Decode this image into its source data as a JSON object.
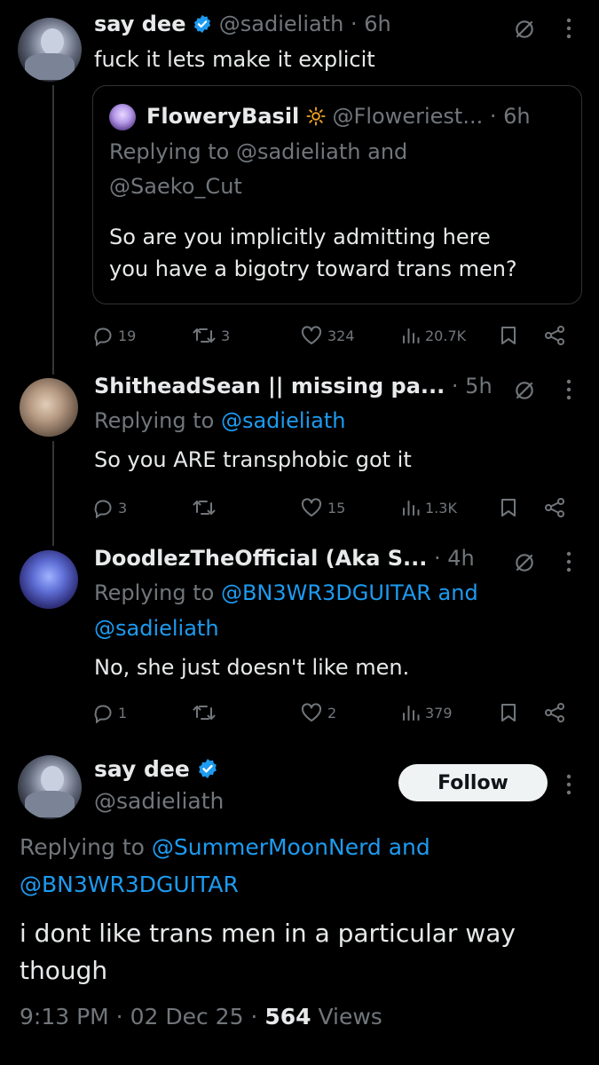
{
  "post1": {
    "display_name": "say dee",
    "handle": "@sadieliath",
    "time": "6h",
    "text": "fuck it lets make it explicit",
    "quote": {
      "display_name": "FloweryBasil",
      "handle": "@Floweriest...",
      "time": "6h",
      "replying_to_label": "Replying to",
      "replying_to_line1": "@sadieliath and",
      "replying_to_line2": "@Saeko_Cut",
      "text_line1": "So are you implicitly admitting here",
      "text_line2": "you have a bigotry toward trans men?"
    },
    "stats": {
      "replies": "19",
      "reposts": "3",
      "likes": "324",
      "views": "20.7K"
    }
  },
  "reply1": {
    "display_name": "ShitheadSean || missing pa...",
    "time": "5h",
    "replying_to_label": "Replying to",
    "replying_to": "@sadieliath",
    "text": "So you ARE transphobic got it",
    "stats": {
      "replies": "3",
      "reposts": "",
      "likes": "15",
      "views": "1.3K"
    }
  },
  "reply2": {
    "display_name": "DoodlezTheOfficial (Aka S...",
    "time": "4h",
    "replying_to_label": "Replying to",
    "replying_to_line1": "@BN3WR3DGUITAR and",
    "replying_to_line2": "@sadieliath",
    "text": "No, she just doesn't like men.",
    "stats": {
      "replies": "1",
      "reposts": "",
      "likes": "2",
      "views": "379"
    }
  },
  "main_post": {
    "display_name": "say dee",
    "handle": "@sadieliath",
    "follow_label": "Follow",
    "replying_to_label": "Replying to",
    "replying_to_line1": "@SummerMoonNerd and",
    "replying_to_line2": "@BN3WR3DGUITAR",
    "text_line1": "i dont like trans men in a particular way",
    "text_line2": "though",
    "time": "9:13 PM",
    "date": "02 Dec 25",
    "views_count": "564",
    "views_label": "Views"
  },
  "colors": {
    "background": "#000000",
    "text": "#e7e9ea",
    "muted": "#71767b",
    "link": "#1d9bf0",
    "verified": "#1d9bf0",
    "border": "#2f3336"
  },
  "icons": [
    "verified-badge-icon",
    "grok-icon",
    "more-icon",
    "reply-icon",
    "repost-icon",
    "like-icon",
    "views-icon",
    "bookmark-icon",
    "share-icon",
    "sun-icon"
  ]
}
